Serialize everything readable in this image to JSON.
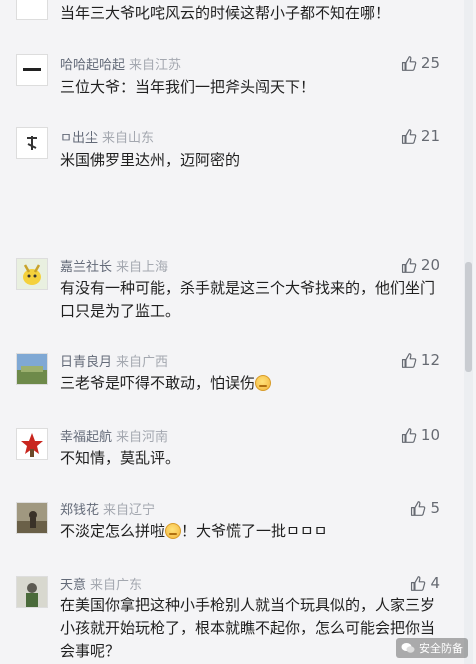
{
  "top_comment": {
    "text": "当年三大爷叱咤风云的时候这帮小子都不知在哪！"
  },
  "comments": [
    {
      "name": "哈哈起哈起",
      "location": "来自江苏",
      "likes": "25",
      "text": "三位大爷：当年我们一把斧头闯天下！"
    },
    {
      "name": "ㅁ出尘",
      "location": "来自山东",
      "likes": "21",
      "text": "米国佛罗里达州，迈阿密的"
    },
    {
      "name": "嘉兰社长",
      "location": "来自上海",
      "likes": "20",
      "text": "有没有一种可能，杀手就是这三个大爷找来的，他们坐门口只是为了监工。"
    },
    {
      "name": "日青良月",
      "location": "来自广西",
      "likes": "12",
      "text": "三老爷是吓得不敢动，怕误伤"
    },
    {
      "name": "幸福起航",
      "location": "来自河南",
      "likes": "10",
      "text": "不知情，莫乱评。"
    },
    {
      "name": "郑钱花",
      "location": "来自辽宁",
      "likes": "5",
      "text_a": "不淡定怎么拼啦",
      "text_b": "！大爷慌了一批ㅁㅁㅁ"
    },
    {
      "name": "天意",
      "location": "来自广东",
      "likes": "4",
      "text": "在美国你拿把这种小手枪别人就当个玩具似的，人家三岁小孩就开始玩枪了，根本就瞧不起你，怎么可能会把你当会事呢？"
    }
  ],
  "watermark": {
    "text": "安全防备"
  },
  "icons": {
    "like": "thumbs-up-icon",
    "watermark": "wechat-icon"
  },
  "colors": {
    "nickname": "#636a78",
    "location": "#a4a8b0",
    "background": "#f4f4f6"
  }
}
